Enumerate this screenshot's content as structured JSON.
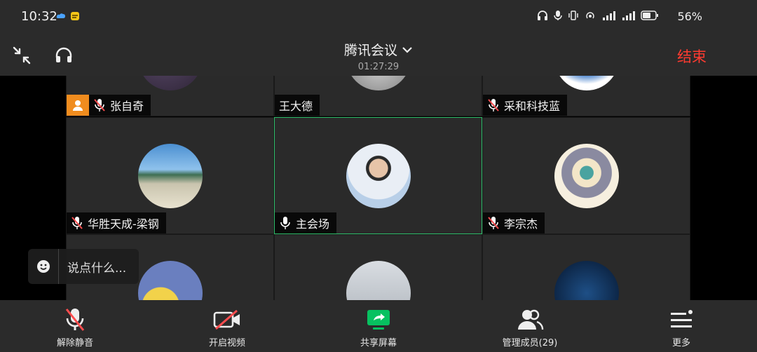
{
  "status_bar": {
    "time": "10:32",
    "battery": "56%"
  },
  "top_bar": {
    "title": "腾讯会议",
    "timer": "01:27:29",
    "end_label": "结束"
  },
  "participants": [
    {
      "name": "张自奇",
      "host": true,
      "muted": true
    },
    {
      "name": "王大德",
      "host": false,
      "muted": null
    },
    {
      "name": "采和科技蓝",
      "host": false,
      "muted": true
    },
    {
      "name": "华胜天成-梁钢",
      "host": false,
      "muted": true
    },
    {
      "name": "主会场",
      "host": false,
      "muted": false,
      "active": true
    },
    {
      "name": "李宗杰",
      "host": false,
      "muted": true
    }
  ],
  "chat": {
    "placeholder": "说点什么..."
  },
  "toolbar": {
    "unmute_label": "解除静音",
    "video_label": "开启视频",
    "share_label": "共享屏幕",
    "members_label": "管理成员(29)",
    "more_label": "更多"
  },
  "colors": {
    "end": "#ff3b30",
    "active_border": "#2fbf6b",
    "host_badge": "#f08c1e",
    "share_green": "#07c160"
  }
}
